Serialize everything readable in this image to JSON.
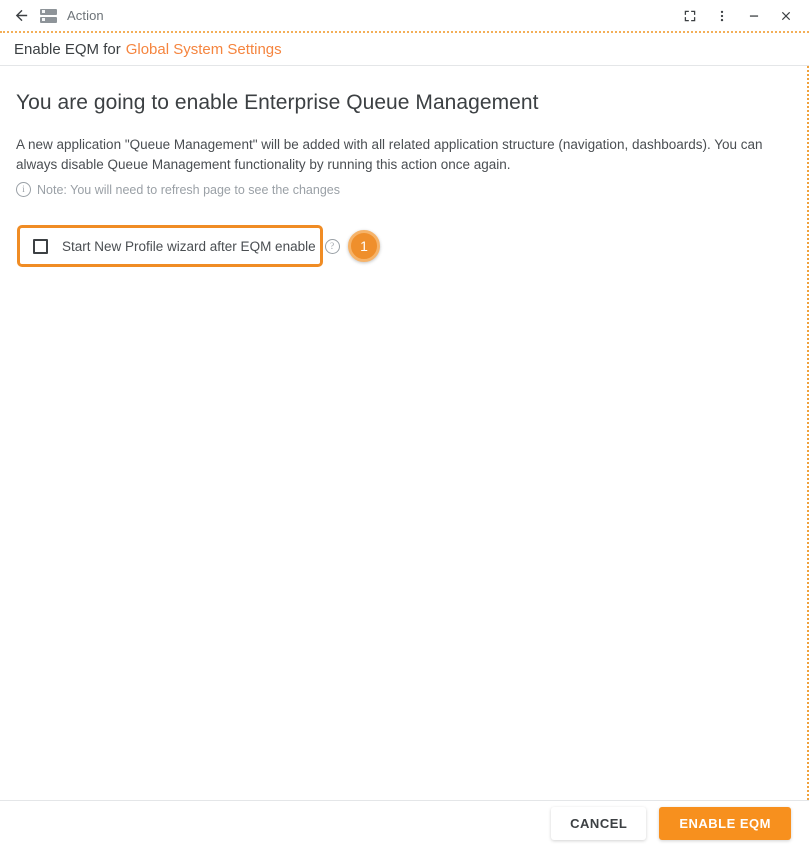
{
  "window": {
    "title": "Action",
    "back_icon": "back-arrow-icon",
    "app_icon": "server-rack-icon",
    "controls": [
      {
        "name": "fullscreen-button",
        "glyph": "fullscreen-icon"
      },
      {
        "name": "more-options-button",
        "glyph": "vertical-dots-icon"
      },
      {
        "name": "minimize-button",
        "glyph": "minimize-icon"
      },
      {
        "name": "close-button",
        "glyph": "close-icon"
      }
    ]
  },
  "action_header": {
    "prefix": "Enable EQM for",
    "target": "Global System Settings"
  },
  "main": {
    "headline": "You are going to enable Enterprise Queue Management",
    "description": "A new application \"Queue Management\" will be added with all related application structure (navigation, dashboards). You can always disable Queue Management functionality by running this action once again.",
    "note": "Note: You will need to refresh page to see the changes",
    "note_icon": "info-icon",
    "checkbox": {
      "label": "Start New Profile wizard after EQM enable",
      "checked": false,
      "help_icon": "help-question-icon"
    },
    "step_badge": "1"
  },
  "footer": {
    "cancel_label": "CANCEL",
    "primary_label": "ENABLE EQM"
  },
  "colors": {
    "accent_orange": "#f7901e",
    "highlight_orange": "#f08c24",
    "link_orange": "#f5853f",
    "text_dark": "#3c4043",
    "text_muted": "#9aa0a6",
    "divider": "#e4e6e8"
  }
}
